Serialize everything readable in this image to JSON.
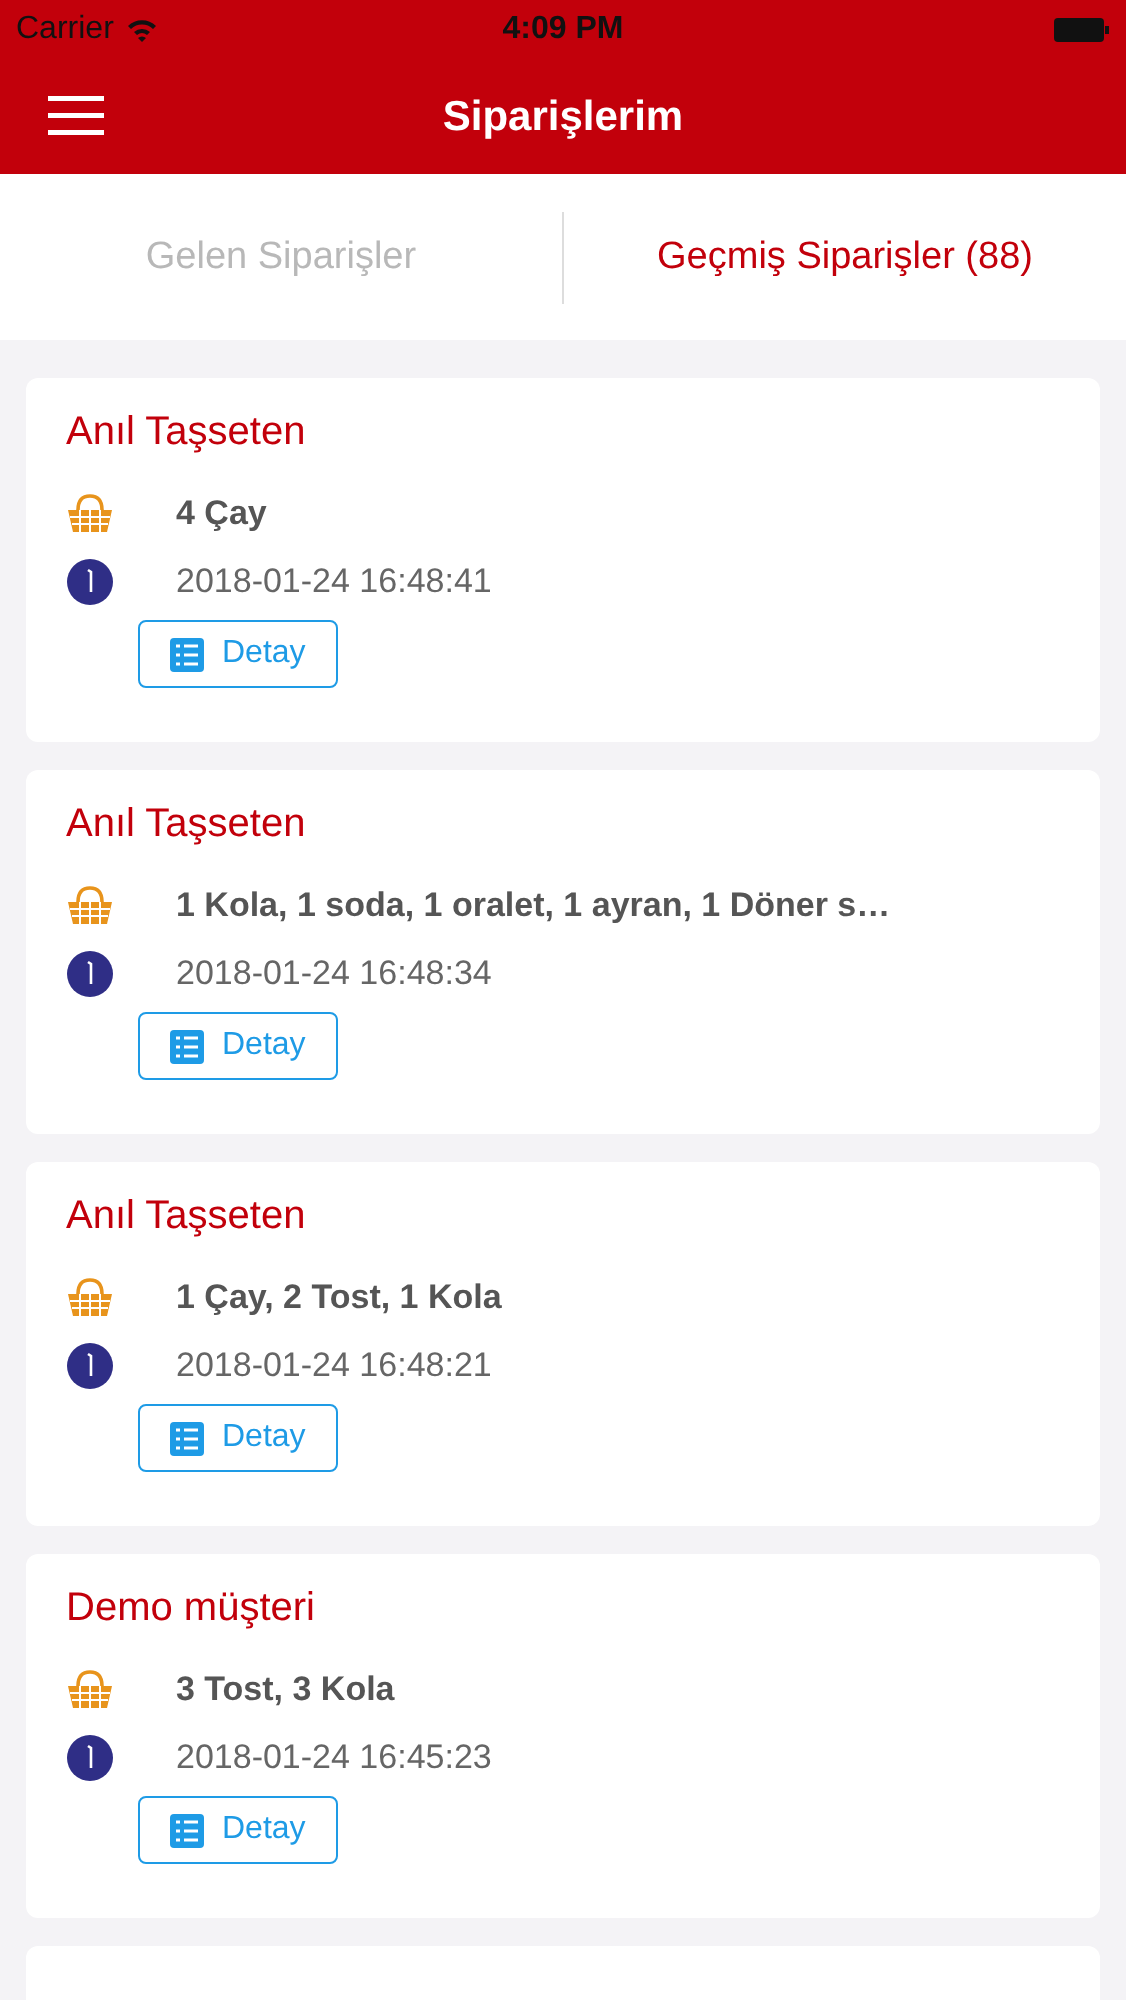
{
  "status_bar": {
    "carrier": "Carrier",
    "time": "4:09 PM"
  },
  "nav": {
    "title": "Siparişlerim"
  },
  "tabs": [
    {
      "label": "Gelen Siparişler",
      "selected": false
    },
    {
      "label": "Geçmiş Siparişler (88)",
      "selected": true
    }
  ],
  "orders": [
    {
      "customer": "Anıl Taşseten",
      "items": "4 Çay",
      "time": "2018-01-24 16:48:41",
      "button": "Detay"
    },
    {
      "customer": "Anıl Taşseten",
      "items": "1 Kola, 1 soda, 1 oralet, 1 ayran, 1 Döner s…",
      "time": "2018-01-24 16:48:34",
      "button": "Detay"
    },
    {
      "customer": "Anıl Taşseten",
      "items": "1 Çay, 2 Tost, 1 Kola",
      "time": "2018-01-24 16:48:21",
      "button": "Detay"
    },
    {
      "customer": "Demo müşteri",
      "items": "3 Tost, 3 Kola",
      "time": "2018-01-24 16:45:23",
      "button": "Detay"
    }
  ]
}
